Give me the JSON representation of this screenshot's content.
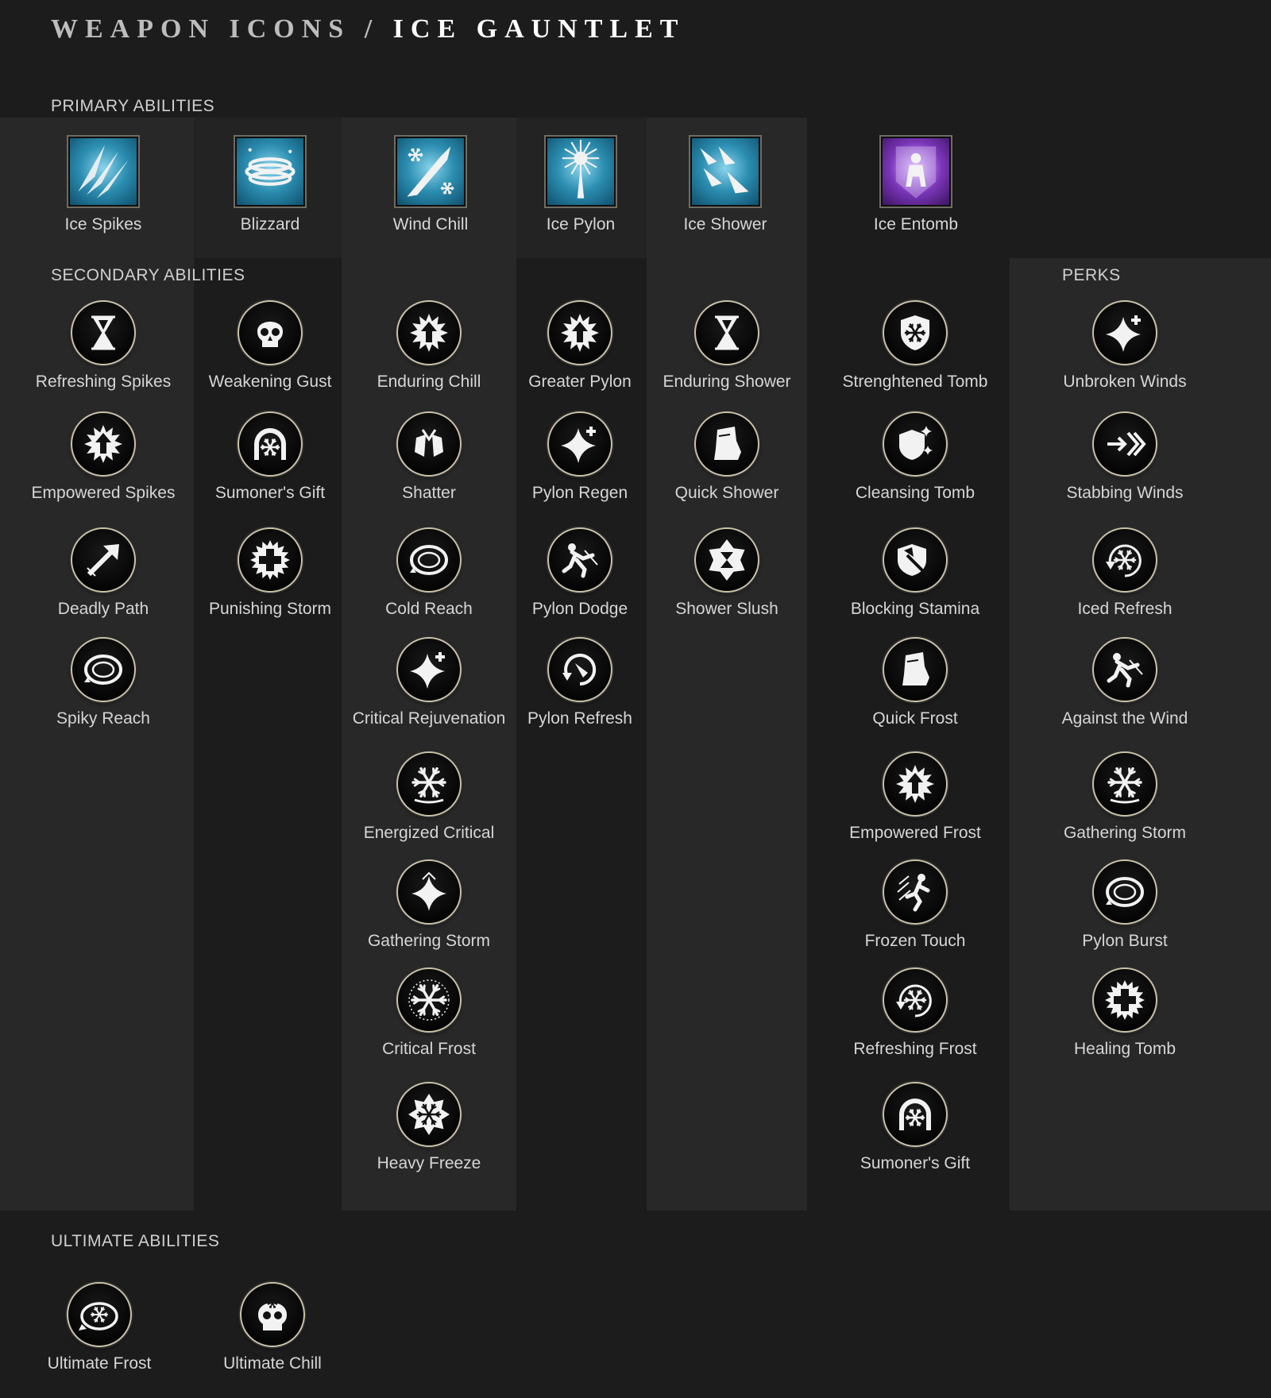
{
  "title": {
    "prefix": "WEAPON ICONS",
    "sep": "/",
    "name": "ICE GAUNTLET"
  },
  "sections": {
    "primary": "PRIMARY ABILITIES",
    "secondary": "SECONDARY ABILITIES",
    "perks": "PERKS",
    "ultimate": "ULTIMATE ABILITIES"
  },
  "colors": {
    "background": "#1c1c1c",
    "band": "#262626",
    "ice_blue": "#2c8eb1",
    "entomb_purple": "#7a36b8"
  },
  "primary_abilities": [
    {
      "label": "Ice Spikes",
      "icon": "ice-spikes-icon"
    },
    {
      "label": "Blizzard",
      "icon": "blizzard-icon"
    },
    {
      "label": "Wind Chill",
      "icon": "wind-chill-icon"
    },
    {
      "label": "Ice Pylon",
      "icon": "ice-pylon-icon"
    },
    {
      "label": "Ice Shower",
      "icon": "ice-shower-icon"
    },
    {
      "label": "Ice Entomb",
      "icon": "ice-entomb-icon"
    }
  ],
  "secondary_columns": [
    [
      {
        "label": "Refreshing Spikes",
        "icon": "hourglass-icon"
      },
      {
        "label": "Empowered Spikes",
        "icon": "starburst-arrow-icon"
      },
      {
        "label": "Deadly Path",
        "icon": "diagonal-arrow-icon"
      },
      {
        "label": "Spiky Reach",
        "icon": "ring-icon"
      }
    ],
    [
      {
        "label": "Weakening Gust",
        "icon": "skull-icon"
      },
      {
        "label": "Sumoner's Gift",
        "icon": "snowflake-arch-icon"
      },
      {
        "label": "Punishing Storm",
        "icon": "cross-burst-icon"
      }
    ],
    [
      {
        "label": "Enduring Chill",
        "icon": "starburst-arrow-icon"
      },
      {
        "label": "Shatter",
        "icon": "shatter-icon"
      },
      {
        "label": "Cold Reach",
        "icon": "ring-icon"
      },
      {
        "label": "Critical Rejuvenation",
        "icon": "sparkle-plus-icon"
      },
      {
        "label": "Energized Critical",
        "icon": "snowflake-icon"
      },
      {
        "label": "Gathering Storm",
        "icon": "sparkle-icon"
      },
      {
        "label": "Critical Frost",
        "icon": "snowflake-burst-icon"
      },
      {
        "label": "Heavy Freeze",
        "icon": "snowflake-frame-icon"
      }
    ],
    [
      {
        "label": "Greater Pylon",
        "icon": "starburst-arrow-icon"
      },
      {
        "label": "Pylon Regen",
        "icon": "sparkle-plus-icon"
      },
      {
        "label": "Pylon Dodge",
        "icon": "dodge-figure-icon"
      },
      {
        "label": "Pylon Refresh",
        "icon": "refresh-arc-icon"
      }
    ],
    [
      {
        "label": "Enduring Shower",
        "icon": "hourglass-icon"
      },
      {
        "label": "Quick Shower",
        "icon": "boot-icon"
      },
      {
        "label": "Shower Slush",
        "icon": "snowflake-hourglass-icon"
      }
    ],
    [
      {
        "label": "Strenghtened Tomb",
        "icon": "shield-snowflake-icon"
      },
      {
        "label": "Cleansing Tomb",
        "icon": "shield-sparkle-icon"
      },
      {
        "label": "Blocking Stamina",
        "icon": "shield-axe-icon"
      },
      {
        "label": "Quick Frost",
        "icon": "boot-icon"
      },
      {
        "label": "Empowered Frost",
        "icon": "starburst-arrow-icon"
      },
      {
        "label": "Frozen Touch",
        "icon": "running-figure-icon"
      },
      {
        "label": "Refreshing Frost",
        "icon": "snowflake-refresh-icon"
      },
      {
        "label": "Sumoner's Gift",
        "icon": "snowflake-arch-icon"
      }
    ]
  ],
  "perks": [
    {
      "label": "Unbroken Winds",
      "icon": "sparkle-plus-icon"
    },
    {
      "label": "Stabbing Winds",
      "icon": "chevron-arrow-icon"
    },
    {
      "label": "Iced Refresh",
      "icon": "snowflake-refresh-icon"
    },
    {
      "label": "Against the Wind",
      "icon": "dodge-figure-icon"
    },
    {
      "label": "Gathering Storm",
      "icon": "snowflake-icon"
    },
    {
      "label": "Pylon Burst",
      "icon": "ring-icon"
    },
    {
      "label": "Healing Tomb",
      "icon": "cross-burst-icon"
    }
  ],
  "ultimate_abilities": [
    {
      "label": "Ultimate Frost",
      "icon": "snowflake-ring-icon"
    },
    {
      "label": "Ultimate Chill",
      "icon": "skull-snowflake-icon"
    }
  ]
}
